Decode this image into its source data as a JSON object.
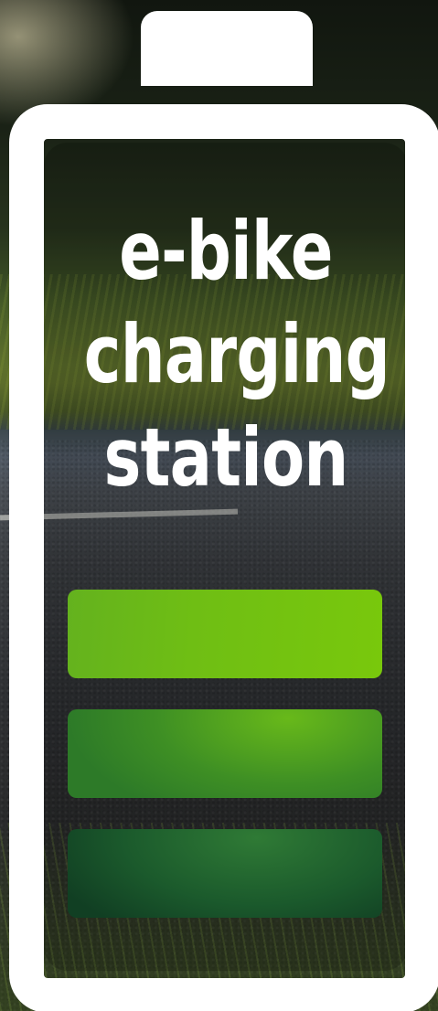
{
  "title": {
    "line1": "e-bike",
    "line2": "charging",
    "line3": "station"
  },
  "battery": {
    "charge_cells": [
      {
        "level": 1,
        "color": "#76c412"
      },
      {
        "level": 2,
        "color": "#3a8c26"
      },
      {
        "level": 3,
        "color": "#174e28"
      }
    ],
    "frame_color": "#ffffff"
  },
  "colors": {
    "text": "#ffffff"
  }
}
